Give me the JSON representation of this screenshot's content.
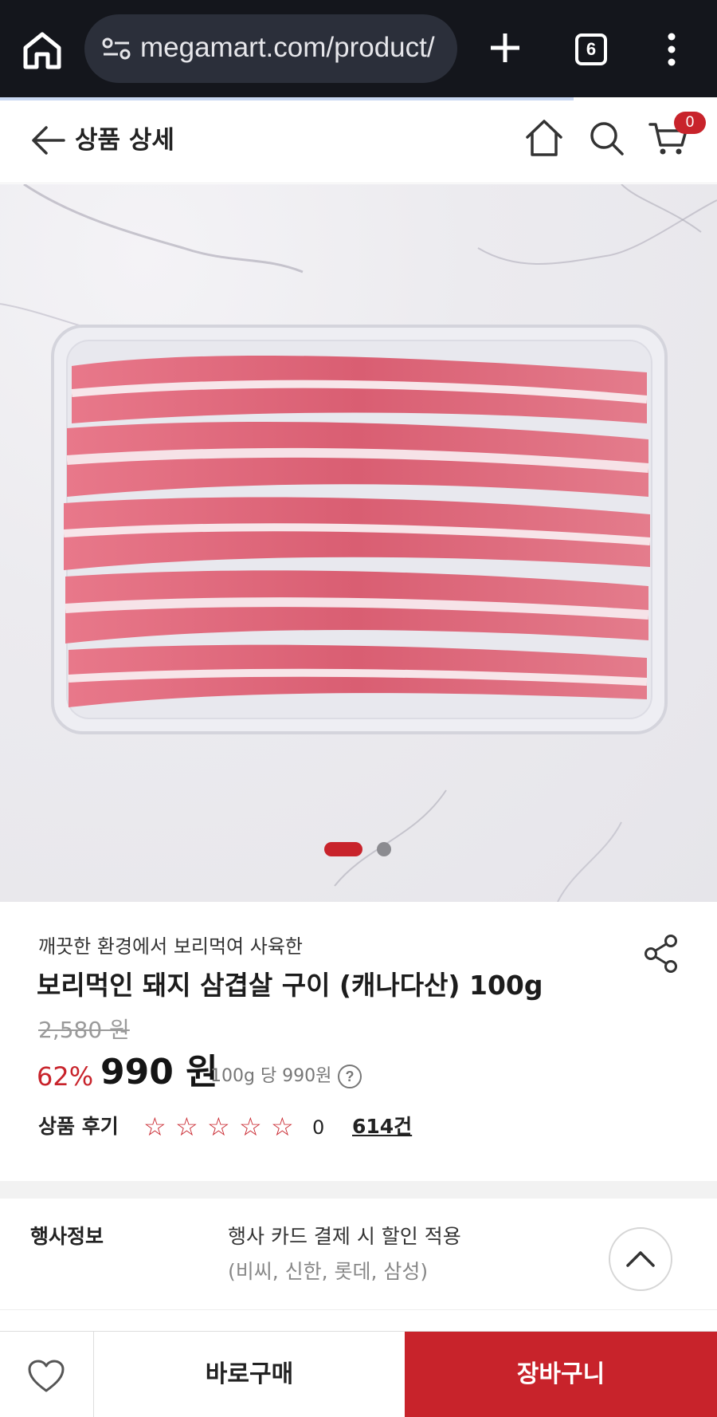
{
  "browser": {
    "url": "megamart.com/product/",
    "tab_count": "6",
    "icons": [
      "home-icon",
      "site-settings-icon",
      "new-tab-icon",
      "tab-switcher-icon",
      "overflow-menu-icon"
    ]
  },
  "header": {
    "title": "상품 상세",
    "cart_count": "0",
    "icons": [
      "back-arrow-icon",
      "home-icon",
      "search-icon",
      "cart-icon"
    ]
  },
  "gallery": {
    "current_slide": 1,
    "total_slides": 2
  },
  "product": {
    "subtitle": "깨끗한 환경에서 보리먹여 사육한",
    "name": "보리먹인 돼지 삼겹살 구이 (캐나다산) 100g",
    "original_price": "2,580 원",
    "discount_rate": "62%",
    "sale_price": "990 원",
    "unit_price": "100g 당 990원",
    "help_symbol": "?"
  },
  "reviews": {
    "label": "상품 후기",
    "stars": [
      "☆",
      "☆",
      "☆",
      "☆",
      "☆"
    ],
    "rating": "0",
    "count": "614건"
  },
  "event": {
    "label": "행사정보",
    "line1": "행사 카드 결제 시 할인 적용",
    "line2": "(비씨, 신한, 롯데, 삼성)"
  },
  "bottom_bar": {
    "buy_now": "바로구매",
    "add_to_cart": "장바구니"
  },
  "colors": {
    "accent": "#c8232b",
    "browser_bar": "#14161c"
  }
}
